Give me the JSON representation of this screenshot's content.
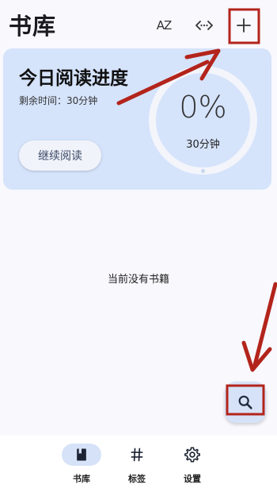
{
  "header": {
    "title": "书库",
    "sort_label": "AZ",
    "sort_icon": "sort-az-icon",
    "more_icon": "code-more-icon",
    "add_icon": "plus-icon"
  },
  "progress_card": {
    "title": "今日阅读进度",
    "remaining": "剩余时间：30分钟",
    "continue_label": "继续阅读",
    "percent": "0%",
    "percent_value": 0,
    "goal_time": "30分钟"
  },
  "empty_state": {
    "message": "当前没有书籍"
  },
  "fab": {
    "icon": "search-icon"
  },
  "bottom_nav": {
    "items": [
      {
        "label": "书库",
        "icon": "book-icon",
        "active": true
      },
      {
        "label": "标签",
        "icon": "hash-icon",
        "active": false
      },
      {
        "label": "设置",
        "icon": "gear-icon",
        "active": false
      }
    ]
  },
  "colors": {
    "accent_container": "#d6e2f7",
    "card_bg": "#d5e3fb",
    "annotation_red": "#b3241b"
  }
}
